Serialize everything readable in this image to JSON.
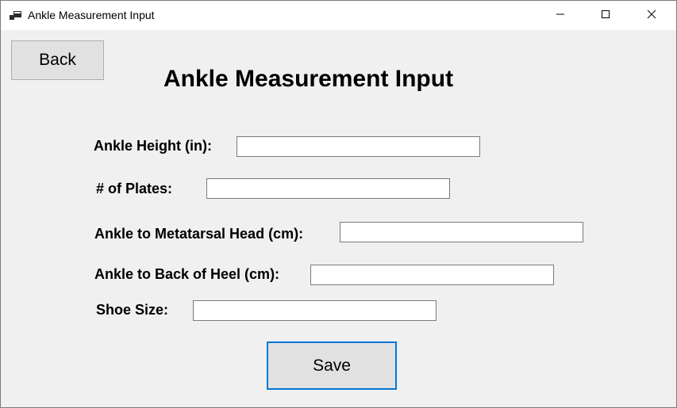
{
  "window": {
    "title": "Ankle Measurement Input"
  },
  "toolbar": {
    "back_label": "Back",
    "save_label": "Save"
  },
  "form": {
    "heading": "Ankle Measurement Input",
    "fields": [
      {
        "label": "Ankle Height (in):",
        "value": ""
      },
      {
        "label": "# of Plates:",
        "value": ""
      },
      {
        "label": "Ankle to Metatarsal Head (cm):",
        "value": ""
      },
      {
        "label": "Ankle to Back of Heel (cm):",
        "value": ""
      },
      {
        "label": "Shoe Size:",
        "value": ""
      }
    ]
  },
  "icons": {
    "app": "app-icon",
    "minimize": "minimize-icon",
    "maximize": "maximize-icon",
    "close": "close-icon"
  },
  "colors": {
    "window_bg": "#f0f0f0",
    "button_bg": "#e1e1e1",
    "focus_border": "#0078d7"
  }
}
